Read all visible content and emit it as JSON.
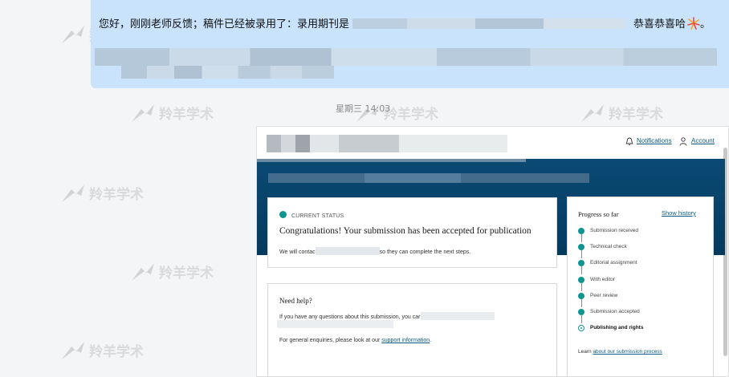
{
  "chat": {
    "message_prefix": "您好，刚刚老师反馈；稿件已经被录用了：录用期刊是",
    "message_suffix": "恭喜恭喜哈",
    "message_end": "。",
    "timestamp": "星期三 14:03"
  },
  "portal": {
    "header": {
      "notifications": "Notifications",
      "account": "Account"
    },
    "status_card": {
      "label": "CURRENT STATUS",
      "title": "Congratulations! Your submission has been accepted for publication",
      "message_start": "We will contac",
      "message_end": "so they can complete the next steps."
    },
    "help_card": {
      "title": "Need help?",
      "line1": "If you have any questions about this submission, you car",
      "line2_prefix": "For general enquiries, please look at our",
      "line2_link": "support information",
      "line2_suffix": "."
    },
    "progress": {
      "title": "Progress so far",
      "show_history": "Show history",
      "steps": [
        {
          "label": "Submission received"
        },
        {
          "label": "Technical check"
        },
        {
          "label": "Editorial assignment"
        },
        {
          "label": "With editor"
        },
        {
          "label": "Peer review"
        },
        {
          "label": "Submission accepted"
        },
        {
          "label": "Publishing and rights"
        }
      ],
      "learn_prefix": "Learn",
      "learn_link": "about our submission process"
    }
  },
  "watermark": "羚羊学术",
  "colors": {
    "bubble": "#c8e3fb",
    "hero": "#0a4a73",
    "accent_teal": "#0f958f",
    "link": "#0c5b7e"
  }
}
